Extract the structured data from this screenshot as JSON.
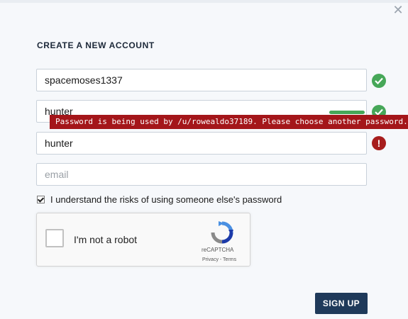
{
  "dialog": {
    "title": "CREATE A NEW ACCOUNT",
    "close_glyph": "✕"
  },
  "form": {
    "username": {
      "value": "spacemoses1337",
      "status_icon": "check-icon",
      "status_color": "#46a758"
    },
    "password": {
      "value": "hunter",
      "status_icon": "check-icon",
      "status_color": "#46a758",
      "strength_color": "#46a758"
    },
    "confirm_password": {
      "value": "hunter",
      "status_icon": "exclamation-icon",
      "status_color": "#a71d1d",
      "status_glyph": "!"
    },
    "email": {
      "value": "",
      "placeholder": "email"
    },
    "error_tooltip": "Password is being used by /u/rowealdo37189. Please choose another password.",
    "risk_checkbox": {
      "checked": true,
      "label": "I understand the risks of using someone else's password"
    }
  },
  "recaptcha": {
    "label": "I'm not a robot",
    "brand": "reCAPTCHA",
    "links": "Privacy - Terms"
  },
  "actions": {
    "signup_label": "SIGN UP",
    "signup_color": "#1f3a5a"
  },
  "colors": {
    "error": "#a4161a",
    "success": "#46a758"
  }
}
